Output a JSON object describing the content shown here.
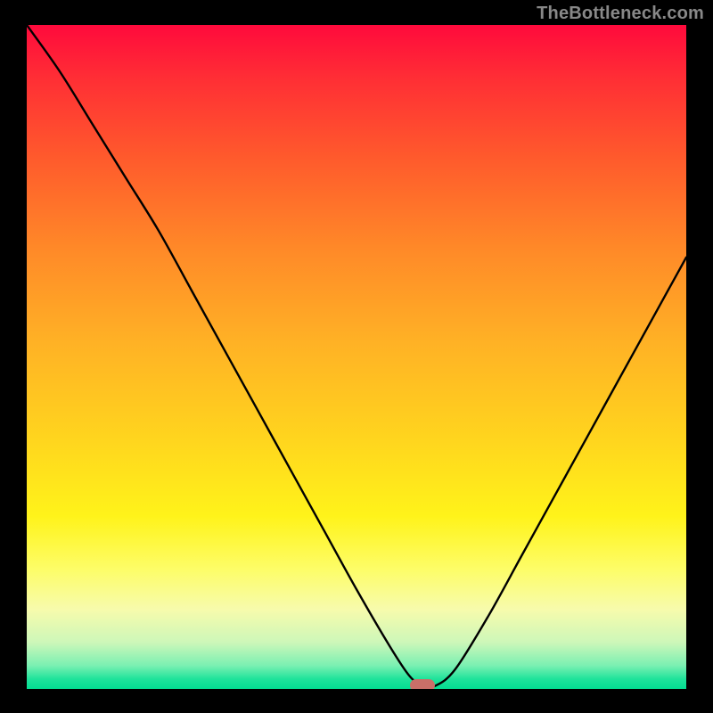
{
  "attribution": "TheBottleneck.com",
  "colors": {
    "frame": "#000000",
    "marker": "#c96f68",
    "curve": "#000000"
  },
  "chart_data": {
    "type": "line",
    "title": "",
    "xlabel": "",
    "ylabel": "",
    "xlim": [
      0,
      100
    ],
    "ylim": [
      0,
      100
    ],
    "series": [
      {
        "name": "bottleneck-curve",
        "x": [
          0,
          5,
          10,
          15,
          20,
          25,
          30,
          35,
          40,
          45,
          50,
          55,
          58,
          60,
          62,
          65,
          70,
          75,
          80,
          85,
          90,
          95,
          100
        ],
        "values": [
          100,
          93,
          85,
          77,
          69,
          60,
          51,
          42,
          33,
          24,
          15,
          6.5,
          2.0,
          0.5,
          0.5,
          3,
          11,
          20,
          29,
          38,
          47,
          56,
          65
        ]
      }
    ],
    "marker": {
      "x": 60,
      "y": 0.5
    },
    "annotations": []
  }
}
